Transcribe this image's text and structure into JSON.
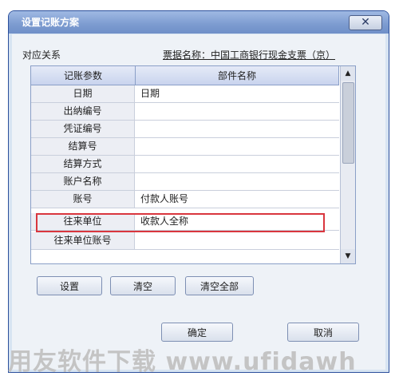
{
  "window": {
    "title": "设置记账方案",
    "close_glyph": "✕"
  },
  "labels": {
    "relation": "对应关系",
    "bill": "票据名称：中国工商银行现金支票（京）"
  },
  "grid": {
    "headers": [
      "记账参数",
      "部件名称"
    ],
    "rows": [
      {
        "param": "日期",
        "part": "日期"
      },
      {
        "param": "出纳编号",
        "part": ""
      },
      {
        "param": "凭证编号",
        "part": ""
      },
      {
        "param": "结算号",
        "part": ""
      },
      {
        "param": "结算方式",
        "part": ""
      },
      {
        "param": "账户名称",
        "part": ""
      },
      {
        "param": "账号",
        "part": "付款人账号"
      },
      {
        "param": "往来单位",
        "part": "收款人全称"
      },
      {
        "param": "往来单位账号",
        "part": ""
      }
    ],
    "highlighted_row": 6
  },
  "buttons": {
    "set": "设置",
    "clear": "清空",
    "clear_all": "清空全部",
    "ok": "确定",
    "cancel": "取消"
  },
  "scroll": {
    "up": "▲",
    "down": "▼"
  },
  "watermark": "用友软件下载 www.ufidawh",
  "colors": {
    "highlight": "#d9363e",
    "title_bar": "#7c9bd0"
  }
}
